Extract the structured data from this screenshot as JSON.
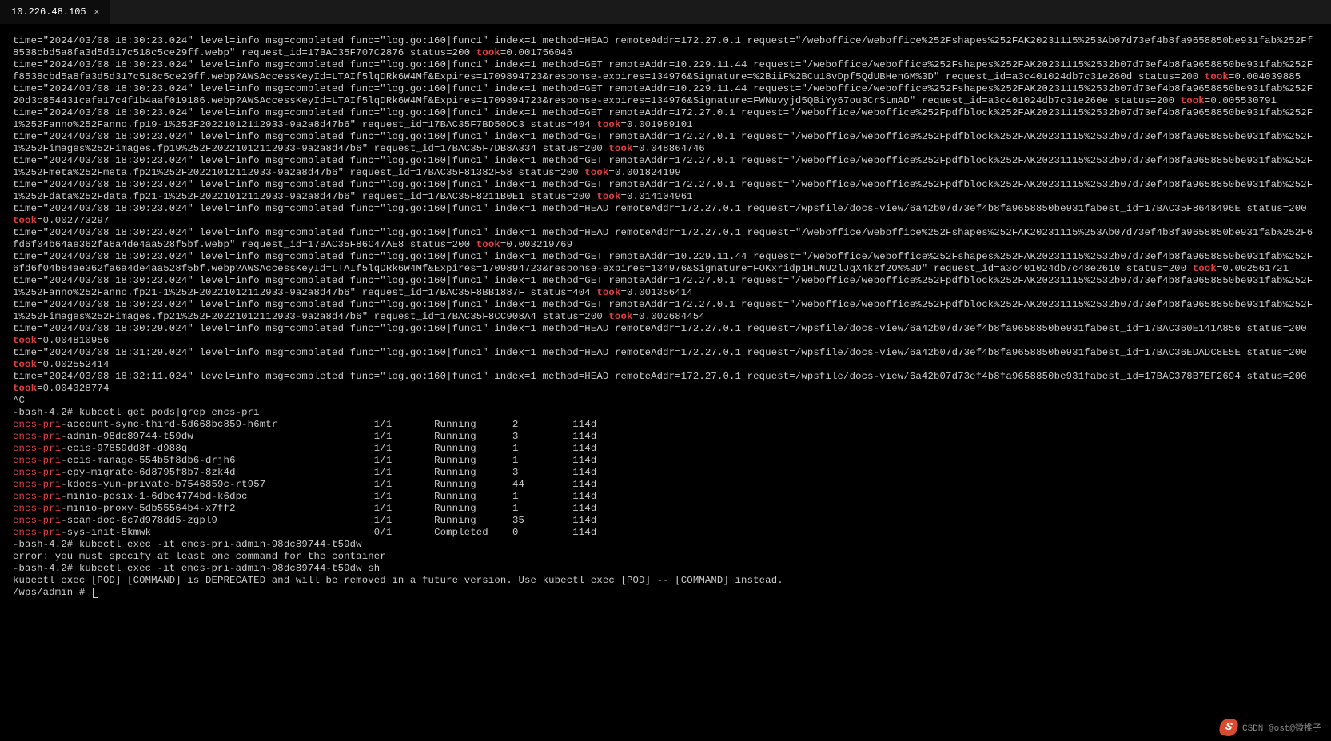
{
  "tab": {
    "title": "10.226.48.105",
    "close": "✕"
  },
  "logs": [
    {
      "pre": "time=\"2024/03/08 18:30:23.024\" level=info msg=completed func=\"log.go:160|func1\" index=1 method=HEAD remoteAddr=172.27.0.1 request=\"/weboffice/weboffice%252Fshapes%252FAK20231115%253Ab07d73ef4b8fa9658850be931fab%252Ff8538cbd5a8fa3d5d317c518c5ce29ff.webp\" request_id=17BAC35F707C2876 status=200 ",
      "post": "=0.001756046"
    },
    {
      "pre": "time=\"2024/03/08 18:30:23.024\" level=info msg=completed func=\"log.go:160|func1\" index=1 method=GET remoteAddr=10.229.11.44 request=\"/weboffice/weboffice%252Fshapes%252FAK20231115%2532b07d73ef4b8fa9658850be931fab%252Ff8538cbd5a8fa3d5d317c518c5ce29ff.webp?AWSAccessKeyId=LTAIf5lqDRk6W4Mf&Expires=1709894723&response-expires=134976&Signature=%2BiiF%2BCu18vDpf5QdUBHenGM%3D\" request_id=a3c401024db7c31e260d status=200 ",
      "post": "=0.004039885"
    },
    {
      "pre": "time=\"2024/03/08 18:30:23.024\" level=info msg=completed func=\"log.go:160|func1\" index=1 method=GET remoteAddr=10.229.11.44 request=\"/weboffice/weboffice%252Fshapes%252FAK20231115%2532b07d73ef4b8fa9658850be931fab%252F20d3c854431cafa17c4f1b4aaf019186.webp?AWSAccessKeyId=LTAIf5lqDRk6W4Mf&Expires=1709894723&response-expires=134976&Signature=FWNuvyjd5QBiYy67ou3CrSLmAD\" request_id=a3c401024db7c31e260e status=200 ",
      "post": "=0.005530791"
    },
    {
      "pre": "time=\"2024/03/08 18:30:23.024\" level=info msg=completed func=\"log.go:160|func1\" index=1 method=GET remoteAddr=172.27.0.1 request=\"/weboffice/weboffice%252Fpdfblock%252FAK20231115%2532b07d73ef4b8fa9658850be931fab%252F1%252Fanno%252Fanno.fp19-1%252F20221012112933-9a2a8d47b6\" request_id=17BAC35F7BD50DC3 status=404 ",
      "post": "=0.001989101"
    },
    {
      "pre": "time=\"2024/03/08 18:30:23.024\" level=info msg=completed func=\"log.go:160|func1\" index=1 method=GET remoteAddr=172.27.0.1 request=\"/weboffice/weboffice%252Fpdfblock%252FAK20231115%2532b07d73ef4b8fa9658850be931fab%252F1%252Fimages%252Fimages.fp19%252F20221012112933-9a2a8d47b6\" request_id=17BAC35F7DB8A334 status=200 ",
      "post": "=0.048864746"
    },
    {
      "pre": "time=\"2024/03/08 18:30:23.024\" level=info msg=completed func=\"log.go:160|func1\" index=1 method=GET remoteAddr=172.27.0.1 request=\"/weboffice/weboffice%252Fpdfblock%252FAK20231115%2532b07d73ef4b8fa9658850be931fab%252F1%252Fmeta%252Fmeta.fp21%252F20221012112933-9a2a8d47b6\" request_id=17BAC35F81382F58 status=200 ",
      "post": "=0.001824199"
    },
    {
      "pre": "time=\"2024/03/08 18:30:23.024\" level=info msg=completed func=\"log.go:160|func1\" index=1 method=GET remoteAddr=172.27.0.1 request=\"/weboffice/weboffice%252Fpdfblock%252FAK20231115%2532b07d73ef4b8fa9658850be931fab%252F1%252Fdata%252Fdata.fp21-1%252F20221012112933-9a2a8d47b6\" request_id=17BAC35F8211B0E1 status=200 ",
      "post": "=0.014104961"
    },
    {
      "pre": "time=\"2024/03/08 18:30:23.024\" level=info msg=completed func=\"log.go:160|func1\" index=1 method=HEAD remoteAddr=172.27.0.1 request=/wpsfile/docs-view/6a42b07d73ef4b8fa9658850be931fabest_id=17BAC35F8648496E status=200 ",
      "post": "=0.002773297"
    },
    {
      "pre": "time=\"2024/03/08 18:30:23.024\" level=info msg=completed func=\"log.go:160|func1\" index=1 method=HEAD remoteAddr=172.27.0.1 request=\"/weboffice/weboffice%252Fshapes%252FAK20231115%253Ab07d73ef4b8fa9658850be931fab%252F6fd6f04b64ae362fa6a4de4aa528f5bf.webp\" request_id=17BAC35F86C47AE8 status=200 ",
      "post": "=0.003219769"
    },
    {
      "pre": "time=\"2024/03/08 18:30:23.024\" level=info msg=completed func=\"log.go:160|func1\" index=1 method=GET remoteAddr=10.229.11.44 request=\"/weboffice/weboffice%252Fshapes%252FAK20231115%2532b07d73ef4b8fa9658850be931fab%252F6fd6f04b64ae362fa6a4de4aa528f5bf.webp?AWSAccessKeyId=LTAIf5lqDRk6W4Mf&Expires=1709894723&response-expires=134976&Signature=FOKxridp1HLNU2lJqX4kzf2O%%3D\" request_id=a3c401024db7c48e2610 status=200 ",
      "post": "=0.002561721"
    },
    {
      "pre": "time=\"2024/03/08 18:30:23.024\" level=info msg=completed func=\"log.go:160|func1\" index=1 method=GET remoteAddr=172.27.0.1 request=\"/weboffice/weboffice%252Fpdfblock%252FAK20231115%2532b07d73ef4b8fa9658850be931fab%252F1%252Fanno%252Fanno.fp21-1%252F20221012112933-9a2a8d47b6\" request_id=17BAC35F8BB1887F status=404 ",
      "post": "=0.001356414"
    },
    {
      "pre": "time=\"2024/03/08 18:30:23.024\" level=info msg=completed func=\"log.go:160|func1\" index=1 method=GET remoteAddr=172.27.0.1 request=\"/weboffice/weboffice%252Fpdfblock%252FAK20231115%2532b07d73ef4b8fa9658850be931fab%252F1%252Fimages%252Fimages.fp21%252F20221012112933-9a2a8d47b6\" request_id=17BAC35F8CC908A4 status=200 ",
      "post": "=0.002684454"
    },
    {
      "pre": "time=\"2024/03/08 18:30:29.024\" level=info msg=completed func=\"log.go:160|func1\" index=1 method=HEAD remoteAddr=172.27.0.1 request=/wpsfile/docs-view/6a42b07d73ef4b8fa9658850be931fabest_id=17BAC360E141A856 status=200 ",
      "post": "=0.004810956"
    },
    {
      "pre": "time=\"2024/03/08 18:31:29.024\" level=info msg=completed func=\"log.go:160|func1\" index=1 method=HEAD remoteAddr=172.27.0.1 request=/wpsfile/docs-view/6a42b07d73ef4b8fa9658850be931fabest_id=17BAC36EDADC8E5E status=200 ",
      "post": "=0.002552414"
    },
    {
      "pre": "time=\"2024/03/08 18:32:11.024\" level=info msg=completed func=\"log.go:160|func1\" index=1 method=HEAD remoteAddr=172.27.0.1 request=/wpsfile/docs-view/6a42b07d73ef4b8fa9658850be931fabest_id=17BAC378B7EF2694 status=200 ",
      "post": "=0.004328774"
    }
  ],
  "interrupt": "^C",
  "prompt1": "-bash-4.2# kubectl get pods|grep encs-pri",
  "took_label": "took",
  "encs_prefix": "encs-pri",
  "pods": [
    {
      "name": "-account-sync-third-5d668bc859-h6mtr",
      "ready": "1/1",
      "status": "Running",
      "restarts": "2",
      "age": "114d"
    },
    {
      "name": "-admin-98dc89744-t59dw",
      "ready": "1/1",
      "status": "Running",
      "restarts": "3",
      "age": "114d"
    },
    {
      "name": "-ecis-97859dd8f-d988q",
      "ready": "1/1",
      "status": "Running",
      "restarts": "1",
      "age": "114d"
    },
    {
      "name": "-ecis-manage-554b5f8db6-drjh6",
      "ready": "1/1",
      "status": "Running",
      "restarts": "1",
      "age": "114d"
    },
    {
      "name": "-epy-migrate-6d8795f8b7-8zk4d",
      "ready": "1/1",
      "status": "Running",
      "restarts": "3",
      "age": "114d"
    },
    {
      "name": "-kdocs-yun-private-b7546859c-rt957",
      "ready": "1/1",
      "status": "Running",
      "restarts": "44",
      "age": "114d"
    },
    {
      "name": "-minio-posix-1-6dbc4774bd-k6dpc",
      "ready": "1/1",
      "status": "Running",
      "restarts": "1",
      "age": "114d"
    },
    {
      "name": "-minio-proxy-5db55564b4-x7ff2",
      "ready": "1/1",
      "status": "Running",
      "restarts": "1",
      "age": "114d"
    },
    {
      "name": "-scan-doc-6c7d978dd5-zgpl9",
      "ready": "1/1",
      "status": "Running",
      "restarts": "35",
      "age": "114d"
    },
    {
      "name": "-sys-init-5kmwk",
      "ready": "0/1",
      "status": "Completed",
      "restarts": "0",
      "age": "114d"
    }
  ],
  "prompt2": "-bash-4.2# kubectl exec -it encs-pri-admin-98dc89744-t59dw",
  "err": "error: you must specify at least one command for the container",
  "prompt3": "-bash-4.2# kubectl exec -it encs-pri-admin-98dc89744-t59dw sh",
  "depr": "kubectl exec [POD] [COMMAND] is DEPRECATED and will be removed in a future version. Use kubectl exec [POD] -- [COMMAND] instead.",
  "prompt4": "/wps/admin # ",
  "watermark": "CSDN @ost@微推子"
}
